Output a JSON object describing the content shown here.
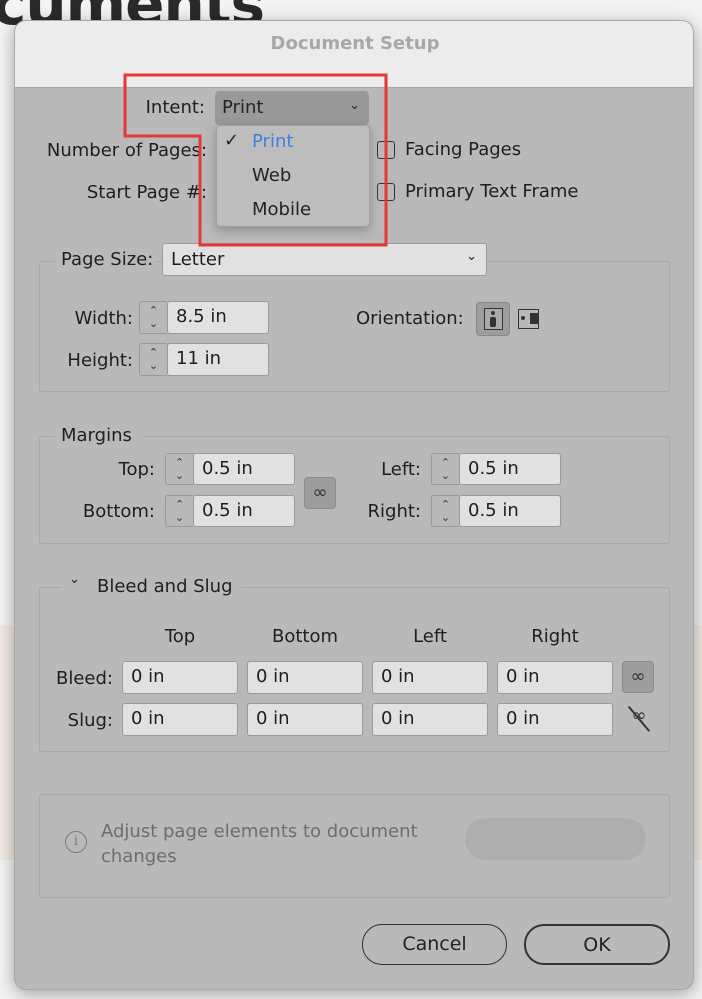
{
  "background": {
    "title_fragment": "cuments"
  },
  "dialog": {
    "title": "Document Setup",
    "intent": {
      "label": "Intent:",
      "value": "Print",
      "options": [
        "Print",
        "Web",
        "Mobile"
      ],
      "selected": "Print"
    },
    "pages": {
      "number_label": "Number of Pages:",
      "start_label": "Start Page #:",
      "facing_pages": "Facing Pages",
      "facing_checked": false,
      "primary_text_frame": "Primary Text Frame",
      "ptf_checked": false
    },
    "page_size": {
      "label": "Page Size:",
      "value": "Letter",
      "width_label": "Width:",
      "width": "8.5 in",
      "height_label": "Height:",
      "height": "11 in",
      "orientation_label": "Orientation:",
      "orientation": "portrait"
    },
    "margins": {
      "legend": "Margins",
      "top_label": "Top:",
      "top": "0.5 in",
      "bottom_label": "Bottom:",
      "bottom": "0.5 in",
      "left_label": "Left:",
      "left": "0.5 in",
      "right_label": "Right:",
      "right": "0.5 in",
      "linked": true
    },
    "bleed_slug": {
      "legend": "Bleed and Slug",
      "columns": [
        "Top",
        "Bottom",
        "Left",
        "Right"
      ],
      "bleed_label": "Bleed:",
      "bleed": [
        "0 in",
        "0 in",
        "0 in",
        "0 in"
      ],
      "slug_label": "Slug:",
      "slug": [
        "0 in",
        "0 in",
        "0 in",
        "0 in"
      ],
      "bleed_linked": true,
      "slug_linked": false
    },
    "adjust": {
      "text": "Adjust page elements to document changes"
    },
    "cancel": "Cancel",
    "ok": "OK"
  },
  "colors": {
    "highlight": "#e53935",
    "selected_option": "#3d7fd9"
  }
}
